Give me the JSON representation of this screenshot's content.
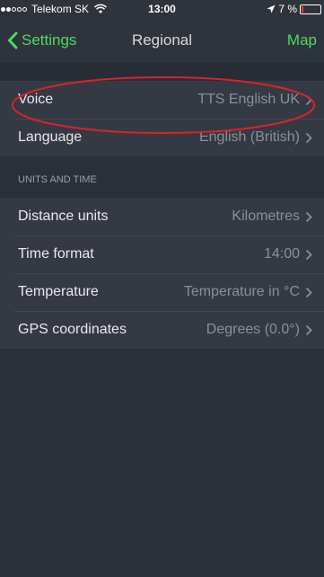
{
  "status_bar": {
    "carrier": "Telekom SK",
    "time": "13:00",
    "battery_text": "7 %"
  },
  "nav": {
    "back_label": "Settings",
    "title": "Regional",
    "right_label": "Map"
  },
  "general": {
    "rows": [
      {
        "label": "Voice",
        "value": "TTS English UK"
      },
      {
        "label": "Language",
        "value": "English (British)"
      }
    ]
  },
  "units_section": {
    "header": "UNITS AND TIME",
    "rows": [
      {
        "label": "Distance units",
        "value": "Kilometres"
      },
      {
        "label": "Time format",
        "value": "14:00"
      },
      {
        "label": "Temperature",
        "value": "Temperature in °C"
      },
      {
        "label": "GPS coordinates",
        "value": "Degrees (0.0°)"
      }
    ]
  },
  "colors": {
    "accent": "#4cd964",
    "background": "#2b2f38",
    "row_background": "#353943",
    "annotation": "#d9232a"
  }
}
